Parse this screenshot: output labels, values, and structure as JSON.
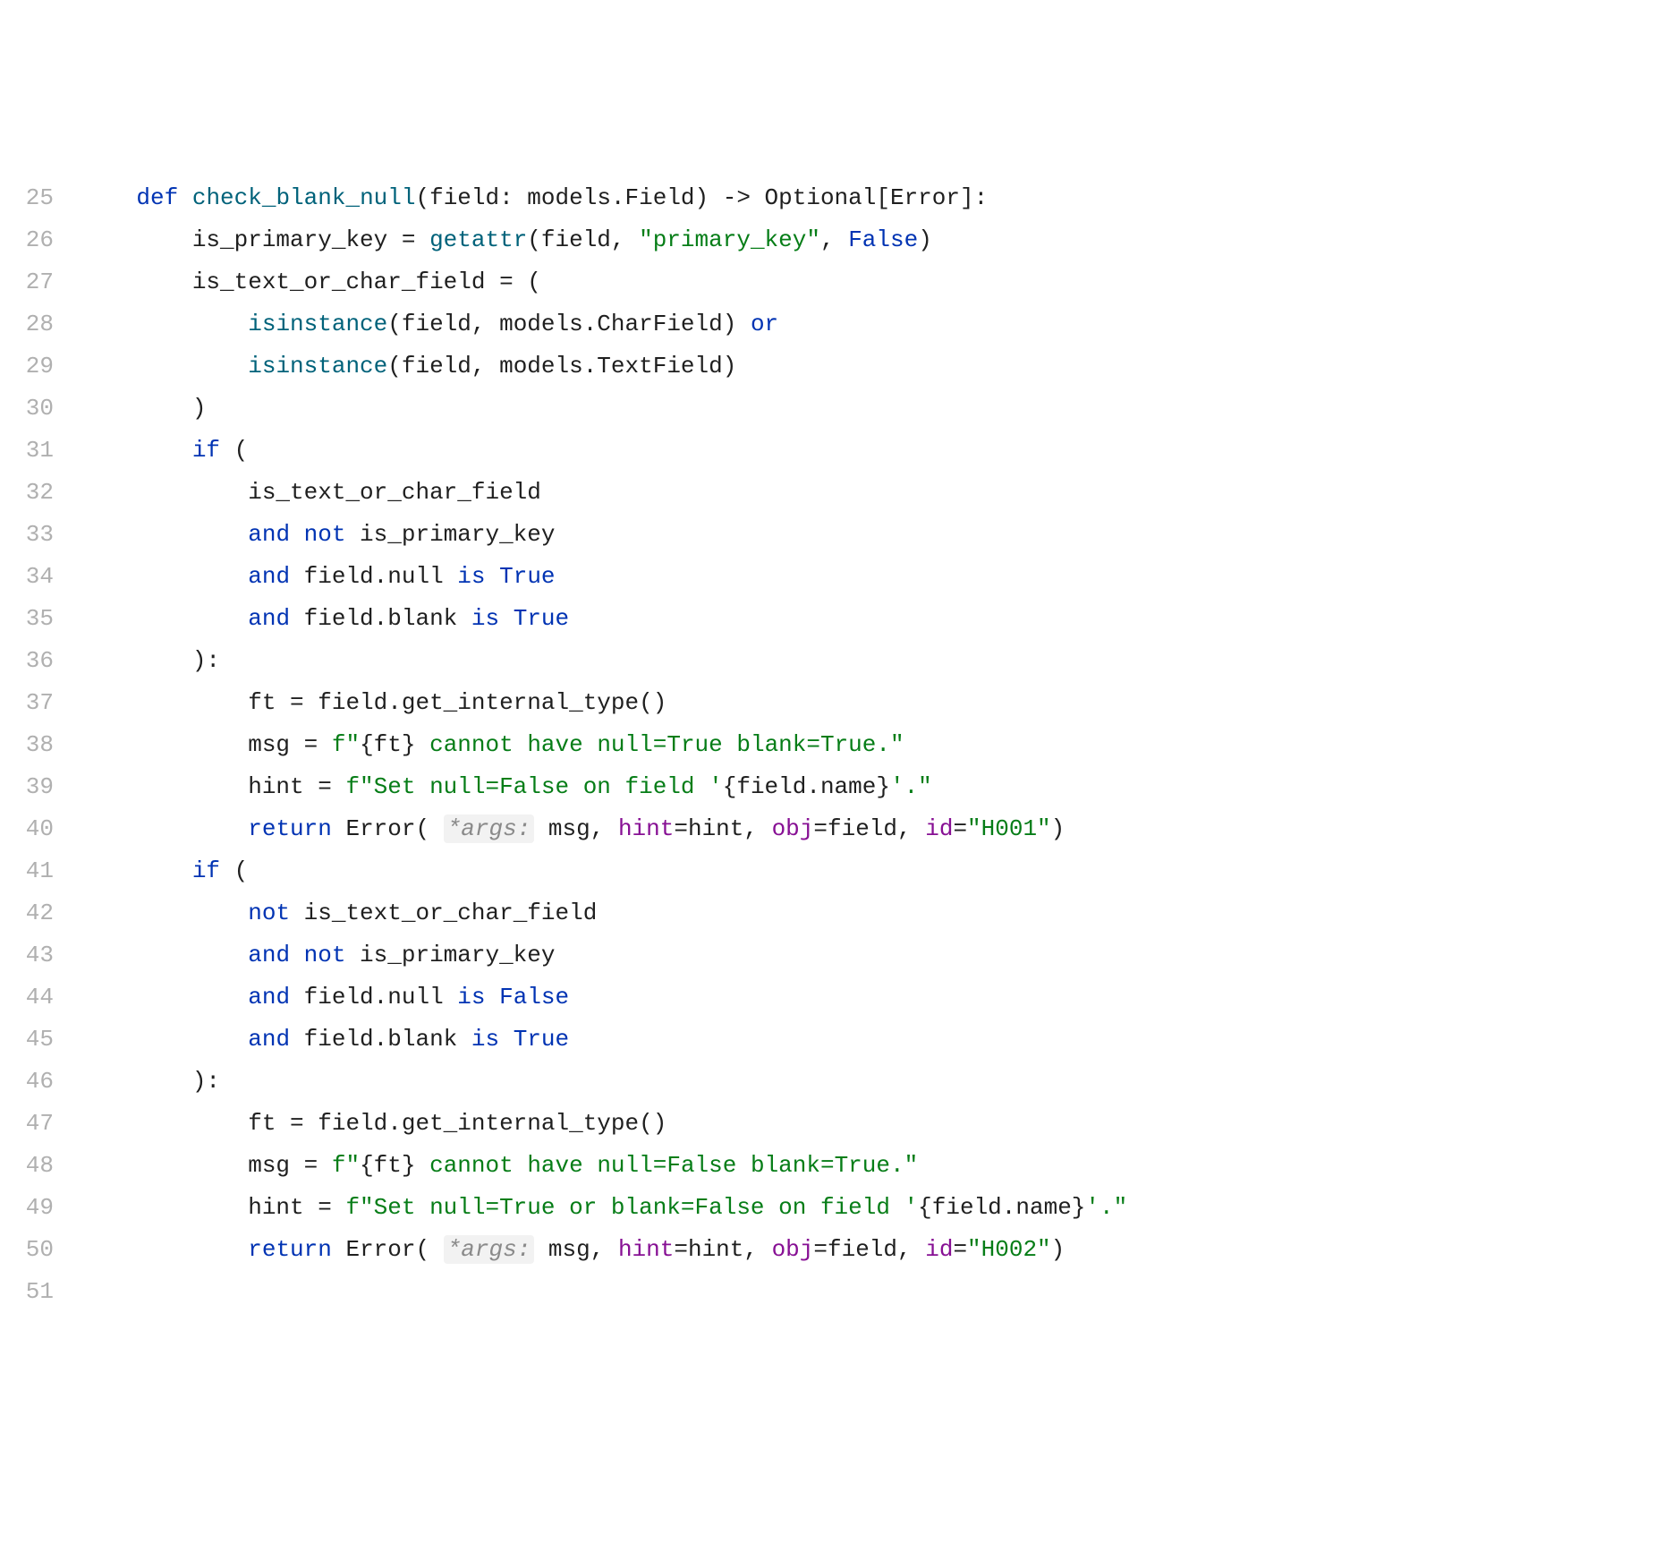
{
  "gutter_start": 25,
  "lines": [
    {
      "n": 25,
      "tokens": [
        {
          "t": "    ",
          "c": "id"
        },
        {
          "t": "def ",
          "c": "kw"
        },
        {
          "t": "check_blank_null",
          "c": "fn"
        },
        {
          "t": "(field: models.Field) -> Optional[Error]:",
          "c": "id"
        }
      ]
    },
    {
      "n": 26,
      "tokens": [
        {
          "t": "        is_primary_key = ",
          "c": "id"
        },
        {
          "t": "getattr",
          "c": "fn"
        },
        {
          "t": "(field, ",
          "c": "id"
        },
        {
          "t": "\"primary_key\"",
          "c": "str"
        },
        {
          "t": ", ",
          "c": "id"
        },
        {
          "t": "False",
          "c": "lit"
        },
        {
          "t": ")",
          "c": "id"
        }
      ]
    },
    {
      "n": 27,
      "tokens": [
        {
          "t": "        is_text_or_char_field = (",
          "c": "id"
        }
      ]
    },
    {
      "n": 28,
      "tokens": [
        {
          "t": "            ",
          "c": "id"
        },
        {
          "t": "isinstance",
          "c": "fn"
        },
        {
          "t": "(field, models.CharField) ",
          "c": "id"
        },
        {
          "t": "or",
          "c": "kw"
        }
      ]
    },
    {
      "n": 29,
      "tokens": [
        {
          "t": "            ",
          "c": "id"
        },
        {
          "t": "isinstance",
          "c": "fn"
        },
        {
          "t": "(field, models.TextField)",
          "c": "id"
        }
      ]
    },
    {
      "n": 30,
      "tokens": [
        {
          "t": "        )",
          "c": "id"
        }
      ]
    },
    {
      "n": 31,
      "tokens": [
        {
          "t": "        ",
          "c": "id"
        },
        {
          "t": "if",
          "c": "kw"
        },
        {
          "t": " (",
          "c": "id"
        }
      ]
    },
    {
      "n": 32,
      "tokens": [
        {
          "t": "            is_text_or_char_field",
          "c": "id"
        }
      ]
    },
    {
      "n": 33,
      "tokens": [
        {
          "t": "            ",
          "c": "id"
        },
        {
          "t": "and not",
          "c": "kw"
        },
        {
          "t": " is_primary_key",
          "c": "id"
        }
      ]
    },
    {
      "n": 34,
      "tokens": [
        {
          "t": "            ",
          "c": "id"
        },
        {
          "t": "and",
          "c": "kw"
        },
        {
          "t": " field.null ",
          "c": "id"
        },
        {
          "t": "is",
          "c": "kw"
        },
        {
          "t": " ",
          "c": "id"
        },
        {
          "t": "True",
          "c": "lit"
        }
      ]
    },
    {
      "n": 35,
      "tokens": [
        {
          "t": "            ",
          "c": "id"
        },
        {
          "t": "and",
          "c": "kw"
        },
        {
          "t": " field.blank ",
          "c": "id"
        },
        {
          "t": "is",
          "c": "kw"
        },
        {
          "t": " ",
          "c": "id"
        },
        {
          "t": "True",
          "c": "lit"
        }
      ]
    },
    {
      "n": 36,
      "tokens": [
        {
          "t": "        ):",
          "c": "id"
        }
      ]
    },
    {
      "n": 37,
      "tokens": [
        {
          "t": "            ft = field.get_internal_type()",
          "c": "id"
        }
      ]
    },
    {
      "n": 38,
      "tokens": [
        {
          "t": "            msg = ",
          "c": "id"
        },
        {
          "t": "f\"",
          "c": "str"
        },
        {
          "t": "{ft}",
          "c": "id"
        },
        {
          "t": " cannot have null=True blank=True.\"",
          "c": "str"
        }
      ]
    },
    {
      "n": 39,
      "tokens": [
        {
          "t": "            hint = ",
          "c": "id"
        },
        {
          "t": "f\"Set null=False on field '",
          "c": "str"
        },
        {
          "t": "{field.name}",
          "c": "id"
        },
        {
          "t": "'.\"",
          "c": "str"
        }
      ]
    },
    {
      "n": 40,
      "tokens": [
        {
          "t": "            ",
          "c": "id"
        },
        {
          "t": "return",
          "c": "kw"
        },
        {
          "t": " Error( ",
          "c": "id"
        },
        {
          "t": "*args:",
          "c": "hint"
        },
        {
          "t": " msg, ",
          "c": "id"
        },
        {
          "t": "hint",
          "c": "attr"
        },
        {
          "t": "=hint, ",
          "c": "id"
        },
        {
          "t": "obj",
          "c": "attr"
        },
        {
          "t": "=field, ",
          "c": "id"
        },
        {
          "t": "id",
          "c": "attr"
        },
        {
          "t": "=",
          "c": "id"
        },
        {
          "t": "\"H001\"",
          "c": "str"
        },
        {
          "t": ")",
          "c": "id"
        }
      ]
    },
    {
      "n": 41,
      "tokens": [
        {
          "t": "        ",
          "c": "id"
        },
        {
          "t": "if",
          "c": "kw"
        },
        {
          "t": " (",
          "c": "id"
        }
      ]
    },
    {
      "n": 42,
      "tokens": [
        {
          "t": "            ",
          "c": "id"
        },
        {
          "t": "not",
          "c": "kw"
        },
        {
          "t": " is_text_or_char_field",
          "c": "id"
        }
      ]
    },
    {
      "n": 43,
      "tokens": [
        {
          "t": "            ",
          "c": "id"
        },
        {
          "t": "and not",
          "c": "kw"
        },
        {
          "t": " is_primary_key",
          "c": "id"
        }
      ]
    },
    {
      "n": 44,
      "tokens": [
        {
          "t": "            ",
          "c": "id"
        },
        {
          "t": "and",
          "c": "kw"
        },
        {
          "t": " field.null ",
          "c": "id"
        },
        {
          "t": "is",
          "c": "kw"
        },
        {
          "t": " ",
          "c": "id"
        },
        {
          "t": "False",
          "c": "lit"
        }
      ]
    },
    {
      "n": 45,
      "tokens": [
        {
          "t": "            ",
          "c": "id"
        },
        {
          "t": "and",
          "c": "kw"
        },
        {
          "t": " field.blank ",
          "c": "id"
        },
        {
          "t": "is",
          "c": "kw"
        },
        {
          "t": " ",
          "c": "id"
        },
        {
          "t": "True",
          "c": "lit"
        }
      ]
    },
    {
      "n": 46,
      "tokens": [
        {
          "t": "        ):",
          "c": "id"
        }
      ]
    },
    {
      "n": 47,
      "tokens": [
        {
          "t": "            ft = field.get_internal_type()",
          "c": "id"
        }
      ]
    },
    {
      "n": 48,
      "tokens": [
        {
          "t": "            msg = ",
          "c": "id"
        },
        {
          "t": "f\"",
          "c": "str"
        },
        {
          "t": "{ft}",
          "c": "id"
        },
        {
          "t": " cannot have null=False blank=True.\"",
          "c": "str"
        }
      ]
    },
    {
      "n": 49,
      "tokens": [
        {
          "t": "            hint = ",
          "c": "id"
        },
        {
          "t": "f\"Set null=True or blank=False on field '",
          "c": "str"
        },
        {
          "t": "{field.name}",
          "c": "id"
        },
        {
          "t": "'.\"",
          "c": "str"
        }
      ]
    },
    {
      "n": 50,
      "tokens": [
        {
          "t": "            ",
          "c": "id"
        },
        {
          "t": "return",
          "c": "kw"
        },
        {
          "t": " Error( ",
          "c": "id"
        },
        {
          "t": "*args:",
          "c": "hint"
        },
        {
          "t": " msg, ",
          "c": "id"
        },
        {
          "t": "hint",
          "c": "attr"
        },
        {
          "t": "=hint, ",
          "c": "id"
        },
        {
          "t": "obj",
          "c": "attr"
        },
        {
          "t": "=field, ",
          "c": "id"
        },
        {
          "t": "id",
          "c": "attr"
        },
        {
          "t": "=",
          "c": "id"
        },
        {
          "t": "\"H002\"",
          "c": "str"
        },
        {
          "t": ")",
          "c": "id"
        }
      ]
    },
    {
      "n": 51,
      "tokens": [
        {
          "t": "",
          "c": "id"
        }
      ]
    }
  ]
}
